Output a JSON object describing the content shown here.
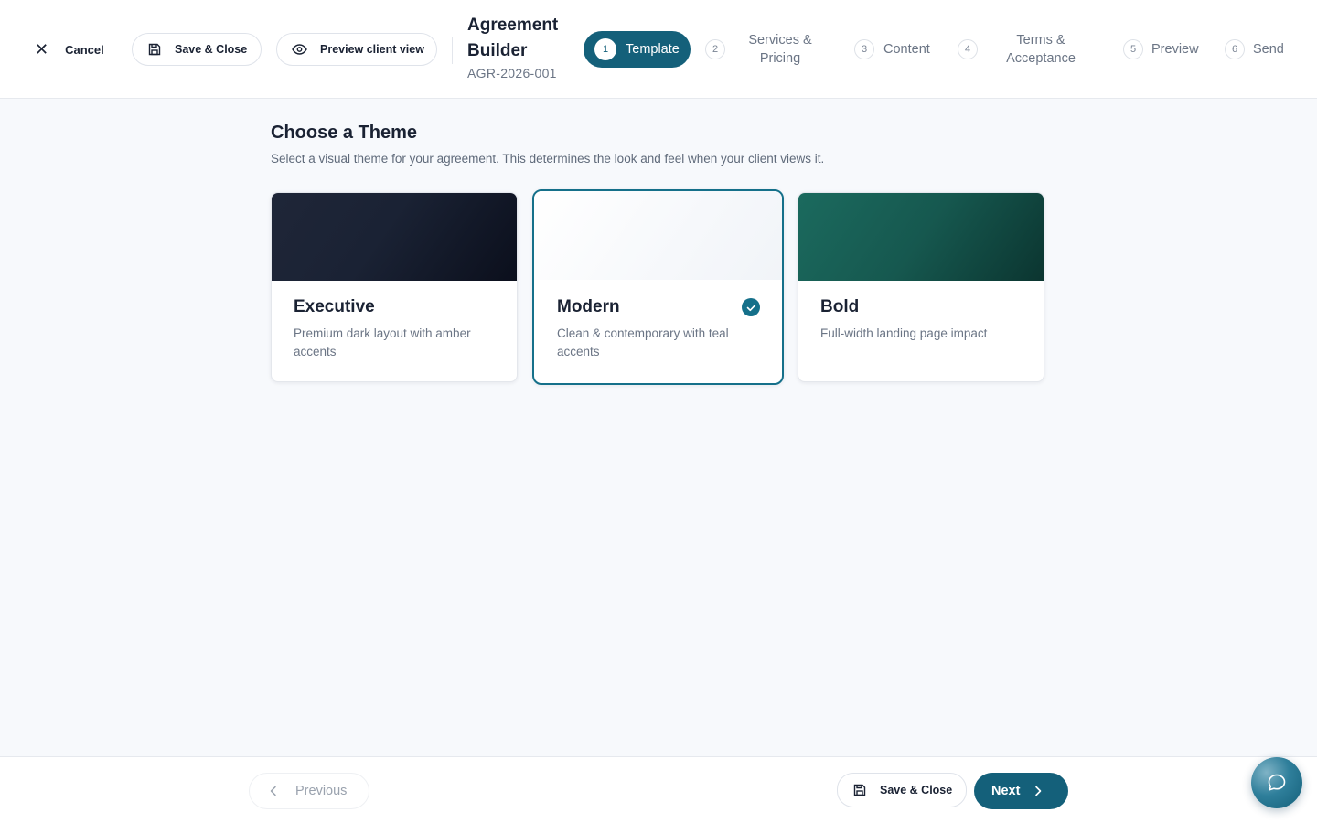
{
  "header": {
    "cancel_label": "Cancel",
    "save_close_label": "Save & Close",
    "preview_label": "Preview client view",
    "title_line1": "Agreement",
    "title_line2": "Builder",
    "agreement_code": "AGR-2026-001"
  },
  "steps": [
    {
      "num": "1",
      "line1": "Template",
      "line2": "",
      "active": true
    },
    {
      "num": "2",
      "line1": "Services &",
      "line2": "Pricing",
      "active": false
    },
    {
      "num": "3",
      "line1": "Content",
      "line2": "",
      "active": false
    },
    {
      "num": "4",
      "line1": "Terms &",
      "line2": "Acceptance",
      "active": false
    },
    {
      "num": "5",
      "line1": "Preview",
      "line2": "",
      "active": false
    },
    {
      "num": "6",
      "line1": "Send",
      "line2": "",
      "active": false
    }
  ],
  "main": {
    "title": "Choose a Theme",
    "subtitle": "Select a visual theme for your agreement. This determines the look and feel when your client views it."
  },
  "themes": [
    {
      "name": "Executive",
      "description": "Premium dark layout with amber accents",
      "selected": false
    },
    {
      "name": "Modern",
      "description": "Clean & contemporary with teal accents",
      "selected": true
    },
    {
      "name": "Bold",
      "description": "Full-width landing page impact",
      "selected": false
    }
  ],
  "footer": {
    "previous_label": "Previous",
    "save_close_label": "Save & Close",
    "next_label": "Next"
  },
  "colors": {
    "accent": "#14607a",
    "background": "#f7f9fc"
  },
  "icons": {
    "cancel": "close-icon",
    "save": "floppy-disk-icon",
    "preview": "eye-icon",
    "selected": "check-icon",
    "previous": "chevron-left-icon",
    "next": "chevron-right-icon",
    "chat": "chat-bubble-icon"
  }
}
